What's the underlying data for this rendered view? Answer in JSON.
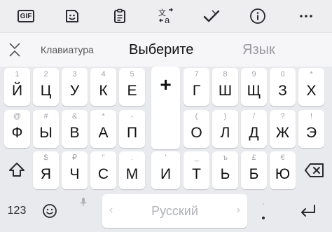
{
  "toolbar": {
    "gif_label": "GIF",
    "icons": [
      "gif-icon",
      "sticker-icon",
      "clipboard-icon",
      "translate-icon",
      "spellcheck-icon",
      "info-icon",
      "more-icon"
    ]
  },
  "suggestions": {
    "collapse_icon": "collapse-icon",
    "items": [
      "Клавиатура",
      "Выберите",
      "Язык"
    ]
  },
  "rows": [
    [
      {
        "hint": "1",
        "label": "Й"
      },
      {
        "hint": "2",
        "label": "Ц"
      },
      {
        "hint": "3",
        "label": "У"
      },
      {
        "hint": "4",
        "label": "К"
      },
      {
        "hint": "5",
        "label": "Е"
      },
      {
        "hint": "7",
        "label": "Г"
      },
      {
        "hint": "8",
        "label": "Ш"
      },
      {
        "hint": "9",
        "label": "Щ"
      },
      {
        "hint": "0",
        "label": "З"
      },
      {
        "hint": "*",
        "label": "Х"
      }
    ],
    [
      {
        "hint": "@",
        "label": "Ф"
      },
      {
        "hint": "#",
        "label": "Ы"
      },
      {
        "hint": "&",
        "label": "В"
      },
      {
        "hint": "*",
        "label": "А"
      },
      {
        "hint": "-",
        "label": "П"
      },
      {
        "hint": "(",
        "label": "О"
      },
      {
        "hint": ")",
        "label": "Л"
      },
      {
        "hint": "/",
        "label": "Д"
      },
      {
        "hint": "?",
        "label": "Ж"
      },
      {
        "hint": "!",
        "label": "Э"
      }
    ],
    [
      {
        "hint": "$",
        "label": "Я"
      },
      {
        "hint": "₽",
        "label": "Ч"
      },
      {
        "hint": "\"",
        "label": "С"
      },
      {
        "hint": ":",
        "label": "М"
      },
      {
        "hint": "'",
        "label": "И"
      },
      {
        "hint": "_",
        "label": "Т"
      },
      {
        "hint": "ъ",
        "label": "Ь"
      },
      {
        "hint": "£",
        "label": "Б"
      },
      {
        "hint": "€",
        "label": "Ю"
      }
    ]
  ],
  "plus_key": "+",
  "shift_icon": "shift-icon",
  "backspace_icon": "backspace-icon",
  "bottom": {
    "numbers_label": "123",
    "emoji_icon": "emoji-icon",
    "mic_icon": "mic-icon",
    "space_label": "Русский",
    "comma_hint": ",",
    "enter_icon": "enter-icon"
  },
  "colors": {
    "background": "#e9eaee",
    "key": "#ffffff",
    "hint": "#a2a4aa",
    "icon": "#2a2a2e"
  }
}
